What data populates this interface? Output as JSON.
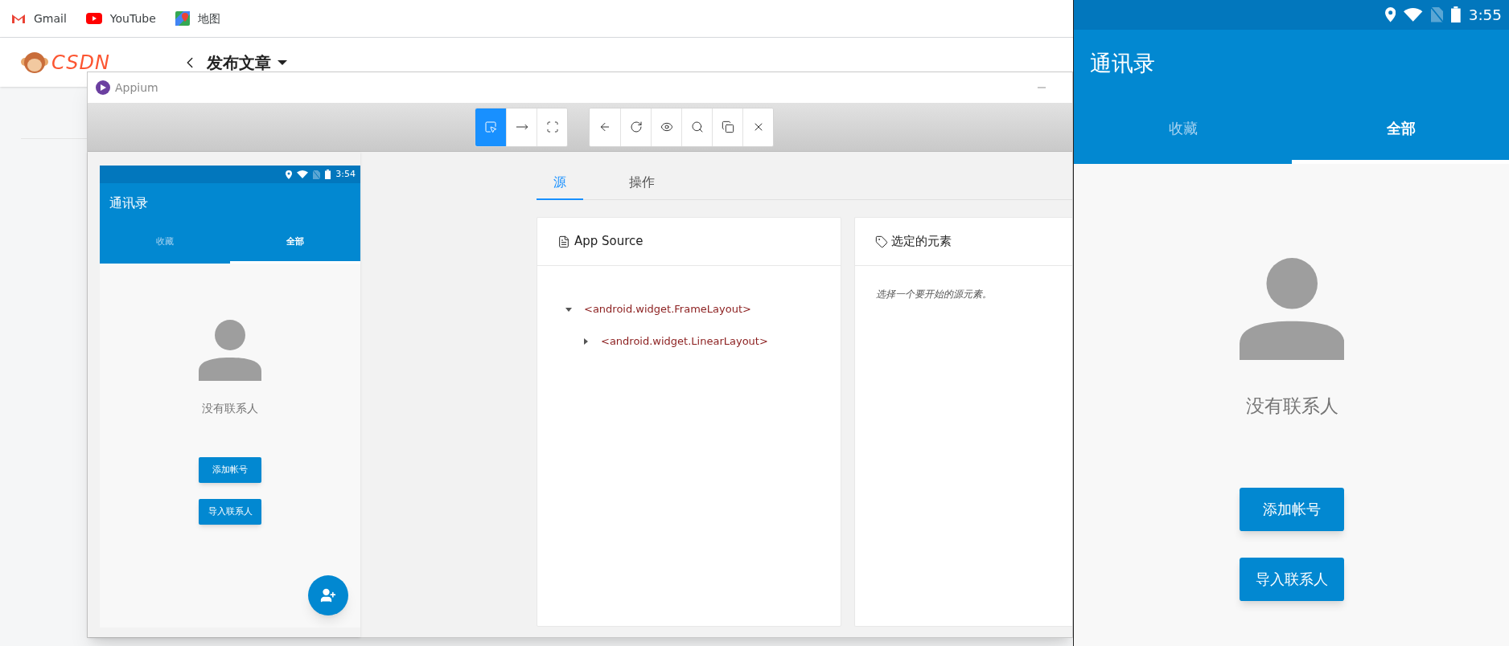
{
  "browser": {
    "bookmarks": [
      {
        "kind": "gmail",
        "label": "Gmail"
      },
      {
        "kind": "youtube",
        "label": "YouTube"
      },
      {
        "kind": "maps",
        "label": "地图"
      }
    ],
    "site_logo": "CSDN",
    "page_title": "发布文章"
  },
  "appium": {
    "title": "Appium",
    "mode_buttons": [
      {
        "kind": "select",
        "selected": true
      },
      {
        "kind": "swipe",
        "selected": false
      },
      {
        "kind": "tap",
        "selected": false
      }
    ],
    "action_buttons": [
      {
        "kind": "back"
      },
      {
        "kind": "refresh"
      },
      {
        "kind": "eye"
      },
      {
        "kind": "search"
      },
      {
        "kind": "copy"
      },
      {
        "kind": "close"
      }
    ],
    "screenshot": {
      "time": "3:54",
      "title": "通讯录",
      "tabs": [
        {
          "label": "收藏",
          "selected": false
        },
        {
          "label": "全部",
          "selected": true
        }
      ],
      "empty_text": "没有联系人",
      "buttons": [
        "添加帐号",
        "导入联系人"
      ],
      "fab": true
    },
    "tabs": [
      {
        "label": "源",
        "selected": true
      },
      {
        "label": "操作",
        "selected": false
      }
    ],
    "source_panel": {
      "title": "App Source",
      "tree": [
        {
          "label": "<android.widget.FrameLayout>",
          "expanded": true,
          "children": [
            {
              "label": "<android.widget.LinearLayout>",
              "expanded": false
            }
          ]
        }
      ]
    },
    "selected_panel": {
      "title": "选定的元素",
      "hint": "选择一个要开始的源元素。"
    }
  },
  "device": {
    "time": "3:55",
    "title": "通讯录",
    "tabs": [
      {
        "label": "收藏",
        "selected": false
      },
      {
        "label": "全部",
        "selected": true
      }
    ],
    "empty_text": "没有联系人",
    "buttons": [
      "添加帐号",
      "导入联系人"
    ]
  }
}
